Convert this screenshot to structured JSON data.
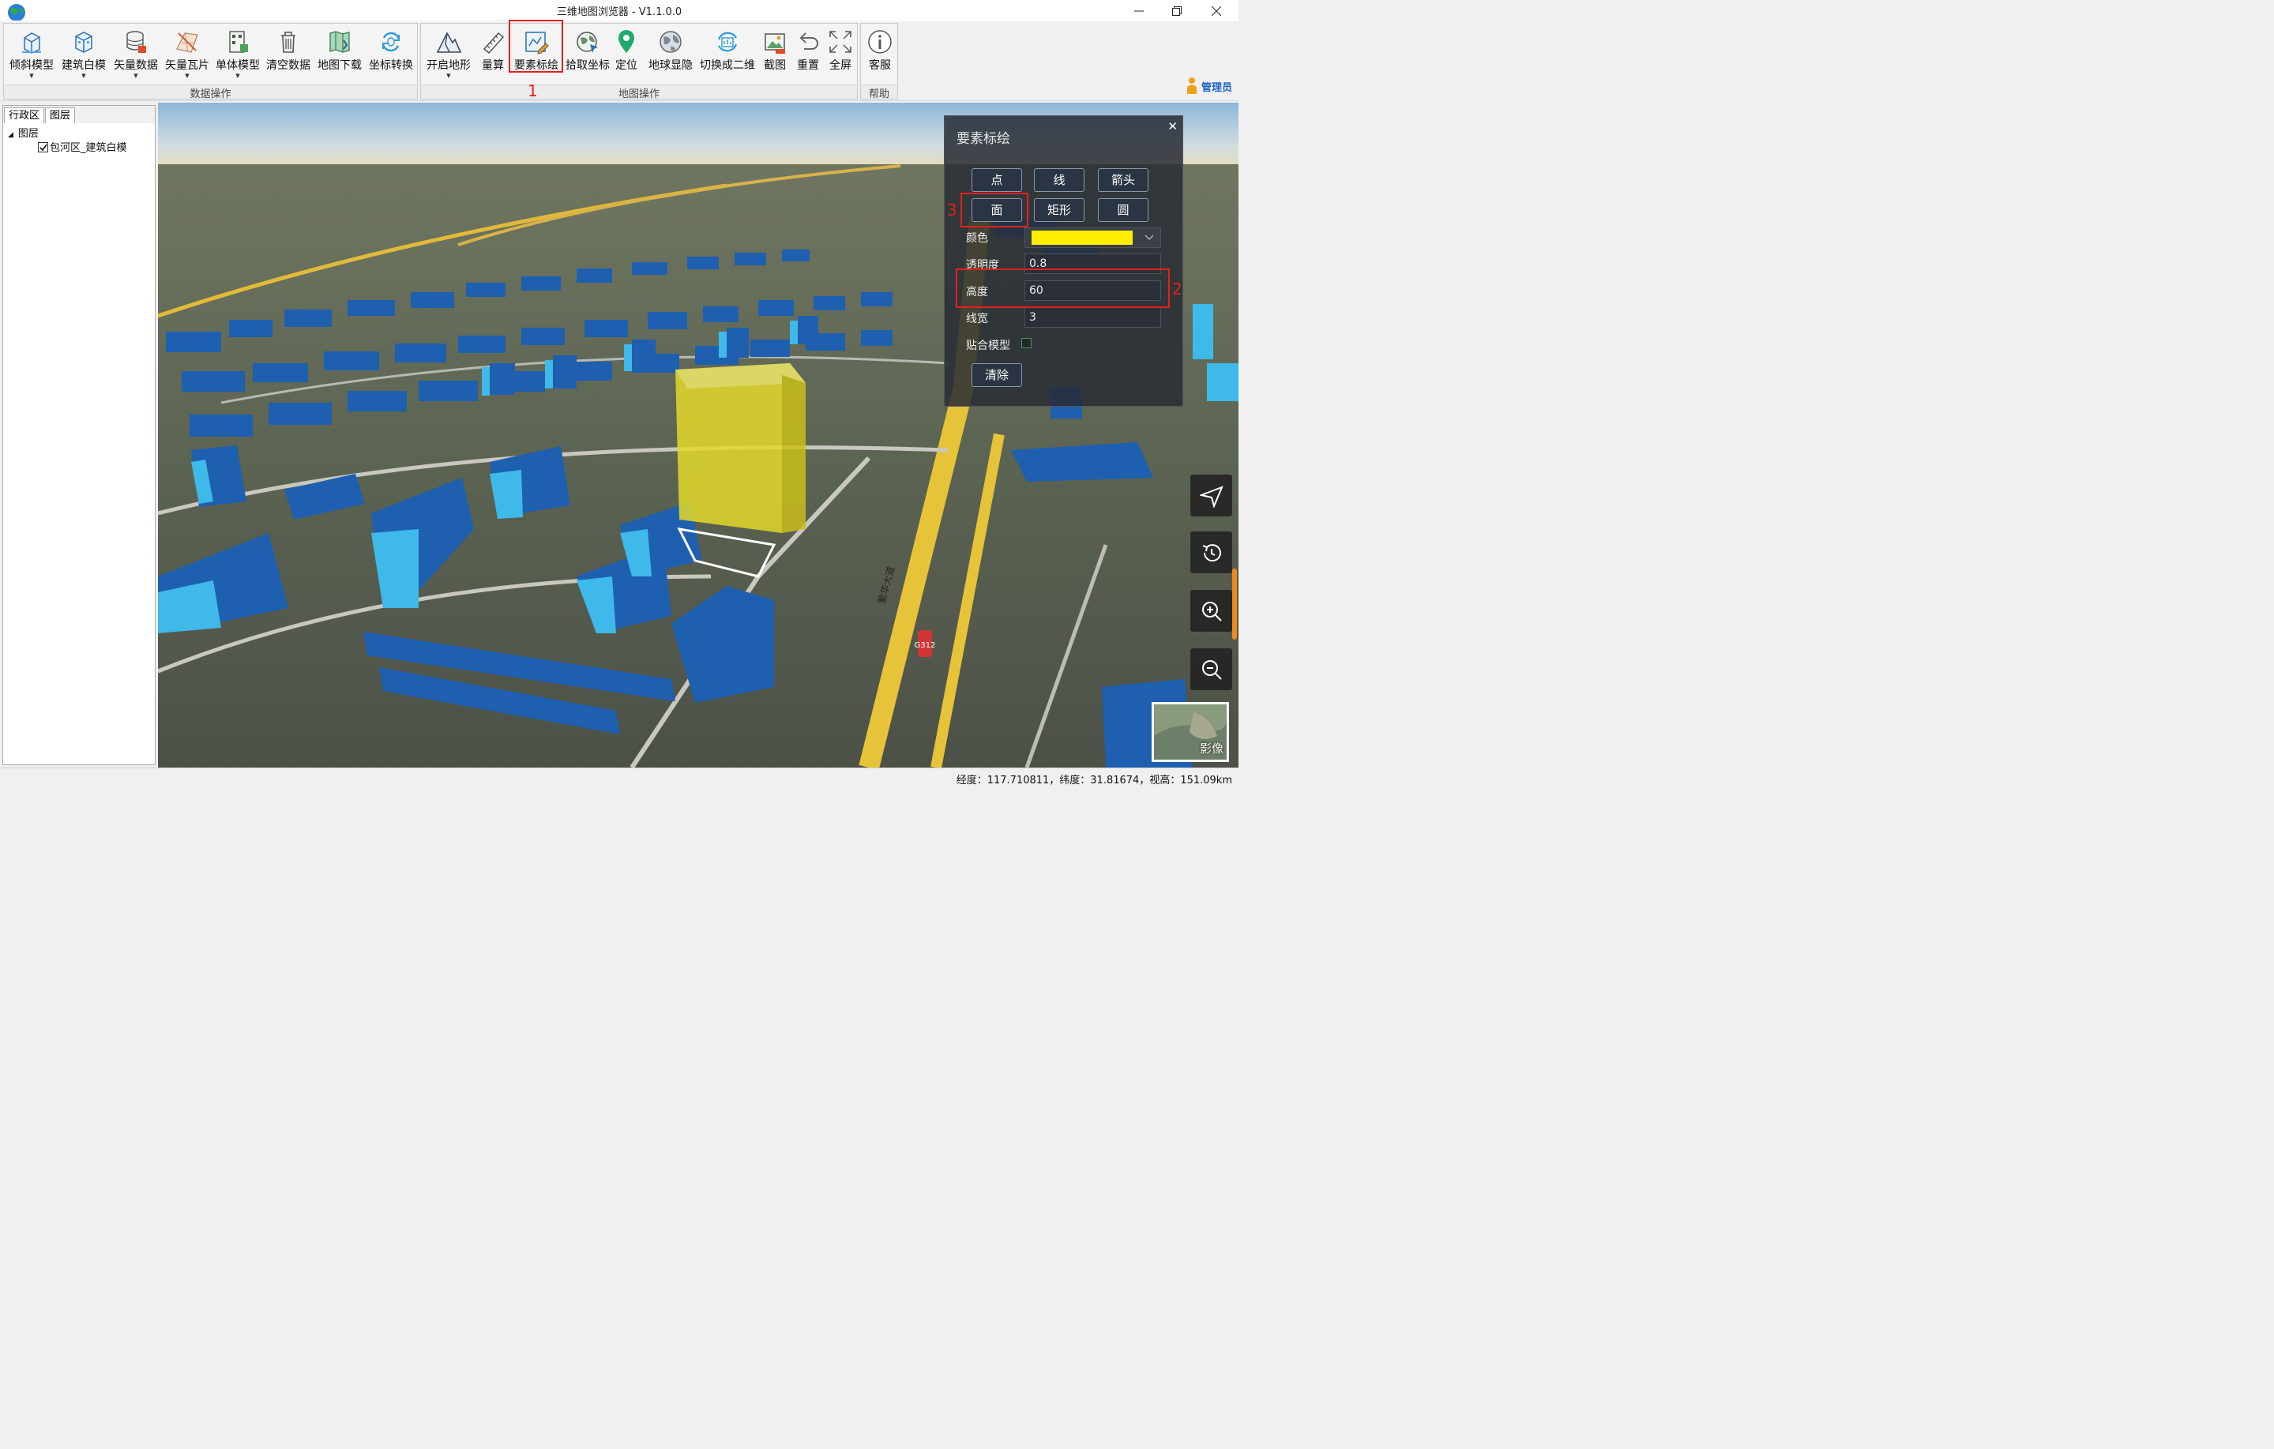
{
  "window": {
    "title": "三维地图浏览器 - V1.1.0.0",
    "controls": [
      "minimize",
      "restore",
      "close"
    ]
  },
  "ribbon": {
    "groups": [
      {
        "label": "数据操作",
        "tools": [
          {
            "label": "倾斜模型",
            "icon": "oblique-model-icon",
            "dropdown": true
          },
          {
            "label": "建筑白模",
            "icon": "building-model-icon",
            "dropdown": true
          },
          {
            "label": "矢量数据",
            "icon": "vector-data-icon",
            "dropdown": true
          },
          {
            "label": "矢量瓦片",
            "icon": "vector-tile-icon",
            "dropdown": true
          },
          {
            "label": "单体模型",
            "icon": "single-model-icon",
            "dropdown": true
          },
          {
            "label": "清空数据",
            "icon": "trash-icon",
            "dropdown": false
          },
          {
            "label": "地图下载",
            "icon": "map-download-icon",
            "dropdown": false
          },
          {
            "label": "坐标转换",
            "icon": "coordinate-convert-icon",
            "dropdown": false
          }
        ]
      },
      {
        "label": "地图操作",
        "tools": [
          {
            "label": "开启地形",
            "icon": "terrain-icon",
            "dropdown": true
          },
          {
            "label": "量算",
            "icon": "ruler-icon",
            "dropdown": false
          },
          {
            "label": "要素标绘",
            "icon": "feature-plot-icon",
            "dropdown": false
          },
          {
            "label": "拾取坐标",
            "icon": "pick-coordinate-icon",
            "dropdown": false
          },
          {
            "label": "定位",
            "icon": "location-pin-icon",
            "dropdown": false
          },
          {
            "label": "地球显隐",
            "icon": "globe-toggle-icon",
            "dropdown": false
          },
          {
            "label": "切换成二维",
            "icon": "switch-2d-icon",
            "dropdown": false
          },
          {
            "label": "截图",
            "icon": "screenshot-icon",
            "dropdown": false
          },
          {
            "label": "重置",
            "icon": "reset-icon",
            "dropdown": false
          },
          {
            "label": "全屏",
            "icon": "fullscreen-icon",
            "dropdown": false
          }
        ]
      },
      {
        "label": "帮助",
        "tools": [
          {
            "label": "客服",
            "icon": "info-icon",
            "dropdown": false
          }
        ]
      }
    ],
    "user": "管理员"
  },
  "left_panel": {
    "tabs": [
      "行政区",
      "图层"
    ],
    "tree": {
      "root": "图层",
      "children": [
        {
          "label": "包河区_建筑白模",
          "checked": true
        }
      ]
    }
  },
  "feature_dialog": {
    "title": "要素标绘",
    "shape_buttons": [
      "点",
      "线",
      "箭头",
      "面",
      "矩形",
      "圆"
    ],
    "fields": {
      "color_label": "颜色",
      "color_value": "#ffee00",
      "opacity_label": "透明度",
      "opacity_value": "0.8",
      "height_label": "高度",
      "height_value": "60",
      "linewidth_label": "线宽",
      "linewidth_value": "3",
      "fit_model_label": "贴合模型",
      "fit_model_checked": false
    },
    "clear_button": "清除"
  },
  "annotations": {
    "step1": "1",
    "step2": "2",
    "step3": "3"
  },
  "map": {
    "minimap_label": "影像",
    "road_label": "G312",
    "road_label2": "繁华大道"
  },
  "status": {
    "text": "经度：117.710811，纬度：31.81674，视高：151.09km"
  },
  "colors": {
    "building": "#1e5fb0",
    "building_light": "#3fb8ea",
    "plotted_polygon": "#e3d92a",
    "highlight": "#e5201a"
  }
}
